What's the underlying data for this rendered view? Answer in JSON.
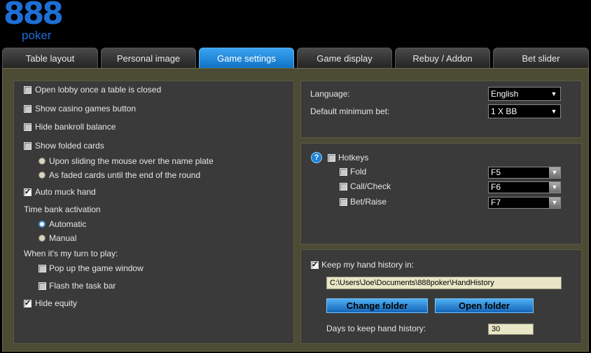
{
  "brand": {
    "number": "888",
    "word": "poker",
    "color": "#1d6fd6"
  },
  "tabs": [
    "Table layout",
    "Personal image",
    "Game settings",
    "Game display",
    "Rebuy / Addon",
    "Bet slider"
  ],
  "active_tab": "Game settings",
  "left": {
    "open_lobby": "Open lobby once a table is closed",
    "show_casino": "Show casino games button",
    "hide_bankroll": "Hide bankroll balance",
    "show_folded": "Show folded cards",
    "upon_sliding": "Upon sliding the mouse over the name plate",
    "faded_cards": "As faded cards until the end of the round",
    "auto_muck": "Auto muck hand",
    "time_bank": "Time bank activation",
    "automatic": "Automatic",
    "manual": "Manual",
    "my_turn": "When it's my turn to play:",
    "popup": "Pop up the game window",
    "flash": "Flash the task bar",
    "hide_equity": "Hide equity"
  },
  "language": {
    "label": "Language:",
    "value": "English"
  },
  "min_bet": {
    "label": "Default minimum bet:",
    "value": "1 X BB"
  },
  "hotkeys": {
    "help": "?",
    "label": "Hotkeys",
    "fold": {
      "label": "Fold",
      "key": "F5"
    },
    "call": {
      "label": "Call/Check",
      "key": "F6"
    },
    "bet": {
      "label": "Bet/Raise",
      "key": "F7"
    }
  },
  "history": {
    "keep_label": "Keep my hand history in:",
    "path": "C:\\Users\\Joe\\Documents\\888poker\\HandHistory",
    "change_btn": "Change folder",
    "open_btn": "Open folder",
    "days_label": "Days to keep hand history:",
    "days_value": "30"
  },
  "tick_glyph": "✓",
  "arrow_glyph": "▼"
}
